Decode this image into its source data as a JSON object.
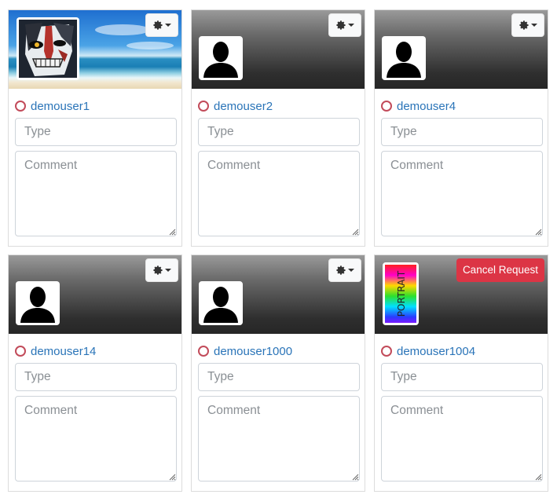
{
  "cards": [
    {
      "username": "demouser1",
      "type_placeholder": "Type",
      "comment_placeholder": "Comment",
      "action": "settings",
      "avatar": "anime-mask",
      "banner": "beach"
    },
    {
      "username": "demouser2",
      "type_placeholder": "Type",
      "comment_placeholder": "Comment",
      "action": "settings",
      "avatar": "silhouette",
      "banner": "gray"
    },
    {
      "username": "demouser4",
      "type_placeholder": "Type",
      "comment_placeholder": "Comment",
      "action": "settings",
      "avatar": "silhouette",
      "banner": "gray"
    },
    {
      "username": "demouser14",
      "type_placeholder": "Type",
      "comment_placeholder": "Comment",
      "action": "settings",
      "avatar": "silhouette",
      "banner": "gray"
    },
    {
      "username": "demouser1000",
      "type_placeholder": "Type",
      "comment_placeholder": "Comment",
      "action": "settings",
      "avatar": "silhouette",
      "banner": "gray"
    },
    {
      "username": "demouser1004",
      "type_placeholder": "Type",
      "comment_placeholder": "Comment",
      "action": "cancel",
      "action_label": "Cancel Request",
      "avatar": "portrait-rainbow",
      "portrait_text": "PORTRAIT",
      "banner": "gray"
    }
  ],
  "icons": {
    "settings": "gear-icon",
    "dropdown": "caret-down-icon",
    "status": "status-ring-icon"
  },
  "colors": {
    "username": "#2a74b8",
    "status_ring": "#c24b5a",
    "cancel": "#dc3545"
  }
}
